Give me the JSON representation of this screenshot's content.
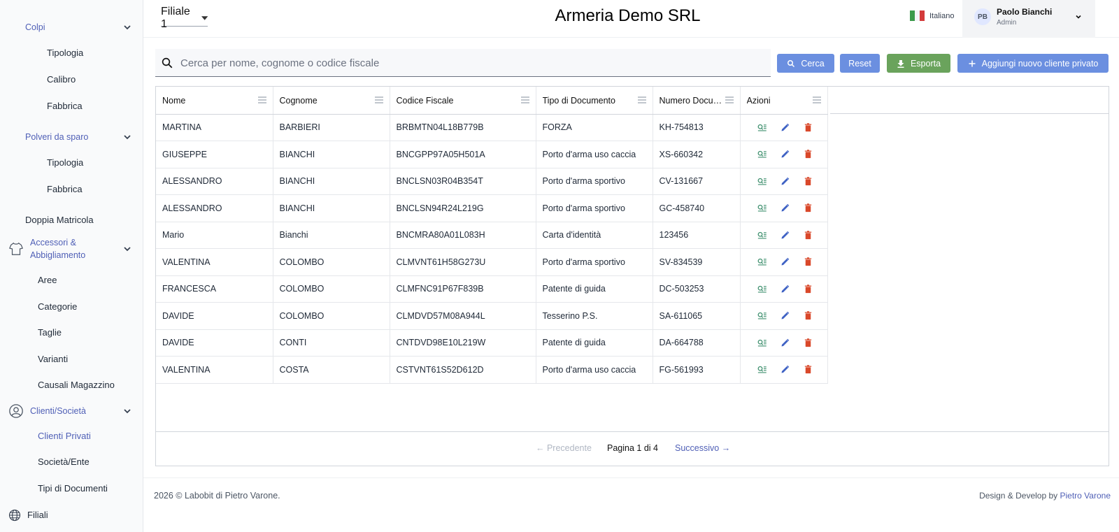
{
  "sidebar": {
    "colpi": "Colpi",
    "colpi_tipologia": "Tipologia",
    "colpi_calibro": "Calibro",
    "colpi_fabbrica": "Fabbrica",
    "polveri": "Polveri da sparo",
    "polveri_tipologia": "Tipologia",
    "polveri_fabbrica": "Fabbrica",
    "doppia_matricola": "Doppia Matricola",
    "accessori_line1": "Accessori &",
    "accessori_line2": "Abbigliamento",
    "aree": "Aree",
    "categorie": "Categorie",
    "taglie": "Taglie",
    "varianti": "Varianti",
    "causali": "Causali Magazzino",
    "clienti": "Clienti/Società",
    "clienti_privati": "Clienti Privati",
    "societa": "Società/Ente",
    "tipi_documenti": "Tipi di Documenti",
    "filiali": "Filiali"
  },
  "header": {
    "branch": "Filiale 1",
    "title": "Armeria Demo SRL",
    "language": "Italiano",
    "user_initials": "PB",
    "user_name": "Paolo Bianchi",
    "user_role": "Admin"
  },
  "toolbar": {
    "search_placeholder": "Cerca per nome, cognome o codice fiscale",
    "search_label": "Cerca",
    "reset_label": "Reset",
    "export_label": "Esporta",
    "add_label": "Aggiungi nuovo cliente privato"
  },
  "table": {
    "columns": [
      "Nome",
      "Cognome",
      "Codice Fiscale",
      "Tipo di Documento",
      "Numero Documento",
      "Azioni"
    ],
    "rows": [
      [
        "MARTINA",
        "BARBIERI",
        "BRBMTN04L18B779B",
        "FORZA",
        "KH-754813"
      ],
      [
        "GIUSEPPE",
        "BIANCHI",
        "BNCGPP97A05H501A",
        "Porto d'arma uso caccia",
        "XS-660342"
      ],
      [
        "ALESSANDRO",
        "BIANCHI",
        "BNCLSN03R04B354T",
        "Porto d'arma sportivo",
        "CV-131667"
      ],
      [
        "ALESSANDRO",
        "BIANCHI",
        "BNCLSN94R24L219G",
        "Porto d'arma sportivo",
        "GC-458740"
      ],
      [
        "Mario",
        "Bianchi",
        "BNCMRA80A01L083H",
        "Carta d'identità",
        "123456"
      ],
      [
        "VALENTINA",
        "COLOMBO",
        "CLMVNT61H58G273U",
        "Porto d'arma sportivo",
        "SV-834539"
      ],
      [
        "FRANCESCA",
        "COLOMBO",
        "CLMFNC91P67F839B",
        "Patente di guida",
        "DC-503253"
      ],
      [
        "DAVIDE",
        "COLOMBO",
        "CLMDVD57M08A944L",
        "Tesserino P.S.",
        "SA-611065"
      ],
      [
        "DAVIDE",
        "CONTI",
        "CNTDVD98E10L219W",
        "Patente di guida",
        "DA-664788"
      ],
      [
        "VALENTINA",
        "COSTA",
        "CSTVNT61S52D612D",
        "Porto d'arma uso caccia",
        "FG-561993"
      ]
    ]
  },
  "pagination": {
    "prev": "← Precedente",
    "info": "Pagina 1 di 4",
    "next": "Successivo →"
  },
  "footer": {
    "copyright": "2026 © Labobit di Pietro Varone.",
    "credit_prefix": "Design & Develop by",
    "credit_name": "Pietro Varone"
  },
  "colors": {
    "search_btn": "#6b8fe0",
    "reset_btn": "#6b8fe0",
    "export_btn": "#6aa35c",
    "add_btn": "#6b8fe0",
    "view_icon": "#3d8f6d",
    "edit_icon": "#3f62c4",
    "delete_icon": "#d9482a"
  }
}
